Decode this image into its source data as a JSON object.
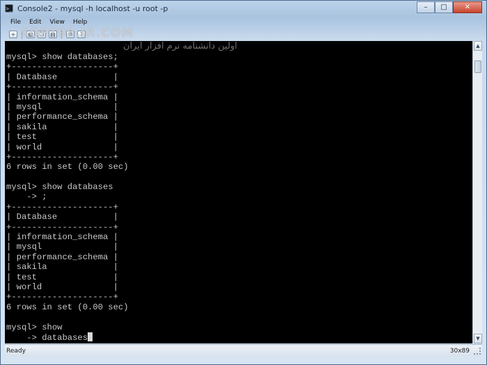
{
  "window": {
    "title": "Console2 - mysql  -h localhost -u root -p",
    "controls": {
      "minimize": "–",
      "maximize": "□",
      "close": "✕"
    }
  },
  "menu": {
    "items": [
      {
        "label": "File"
      },
      {
        "label": "Edit"
      },
      {
        "label": "View"
      },
      {
        "label": "Help"
      }
    ]
  },
  "toolbar": {
    "icons": [
      {
        "name": "new-tab-icon",
        "glyph": "+"
      },
      {
        "name": "open-icon",
        "glyph": "▤"
      },
      {
        "name": "copy-icon",
        "glyph": "❐"
      },
      {
        "name": "paste-icon",
        "glyph": "▦"
      },
      {
        "name": "settings-icon",
        "glyph": "⚙"
      },
      {
        "name": "help-icon",
        "glyph": "?"
      }
    ],
    "watermark_latin": "SOFT98.IR.COM"
  },
  "terminal": {
    "watermark_persian": "اولین دانشنامه نرم افزار ایران",
    "lines": [
      "mysql> show databases;",
      "+--------------------+",
      "| Database           |",
      "+--------------------+",
      "| information_schema |",
      "| mysql              |",
      "| performance_schema |",
      "| sakila             |",
      "| test               |",
      "| world              |",
      "+--------------------+",
      "6 rows in set (0.00 sec)",
      "",
      "mysql> show databases",
      "    -> ;",
      "+--------------------+",
      "| Database           |",
      "+--------------------+",
      "| information_schema |",
      "| mysql              |",
      "| performance_schema |",
      "| sakila             |",
      "| test               |",
      "| world              |",
      "+--------------------+",
      "6 rows in set (0.00 sec)",
      "",
      "mysql> show",
      "    -> databases"
    ]
  },
  "status": {
    "text": "Ready",
    "size": "30x89"
  },
  "colors": {
    "terminal_bg": "#000000",
    "terminal_fg": "#c8c8c8"
  }
}
